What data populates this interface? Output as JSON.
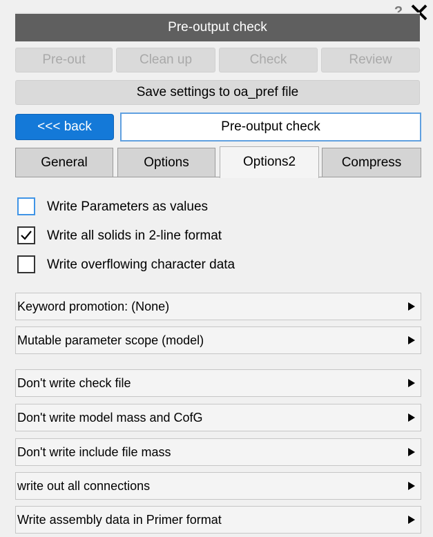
{
  "window": {
    "help_label": "?",
    "title": "Pre-output check"
  },
  "actions": {
    "preout": "Pre-out",
    "cleanup": "Clean up",
    "check": "Check",
    "review": "Review",
    "save_settings": "Save settings to oa_pref file"
  },
  "nav": {
    "back": "<<< back",
    "heading": "Pre-output check"
  },
  "tabs": [
    {
      "label": "General",
      "active": false
    },
    {
      "label": "Options",
      "active": false
    },
    {
      "label": "Options2",
      "active": true
    },
    {
      "label": "Compress",
      "active": false
    }
  ],
  "checkboxes": [
    {
      "label": "Write Parameters as values",
      "checked": false
    },
    {
      "label": "Write all solids in 2-line format",
      "checked": true
    },
    {
      "label": "Write overflowing character data",
      "checked": false
    }
  ],
  "menus": [
    {
      "label": "Keyword promotion: (None)"
    },
    {
      "label": "Mutable parameter scope (model)"
    },
    {
      "label": "Don't write check file"
    },
    {
      "label": "Don't write model mass and CofG"
    },
    {
      "label": "Don't write include file mass"
    },
    {
      "label": "write out all connections"
    },
    {
      "label": "Write assembly data in Primer format"
    }
  ],
  "colors": {
    "title_bar": "#5f5f5f",
    "back_button": "#1479d8",
    "heading_border": "#5fa0e0",
    "disabled_text": "#a9a9a9"
  }
}
